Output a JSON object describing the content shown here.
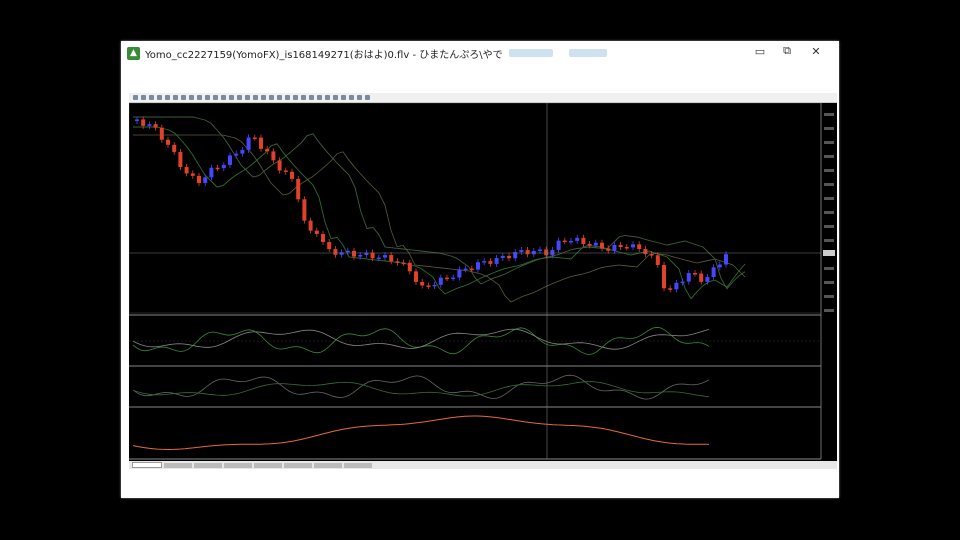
{
  "window": {
    "title": "Yomo_cc2227159(YomoFX)_is168149271(おはよ)0.flv - ひまたんぷろ\\やで",
    "icon_name": "app-icon",
    "controls": [
      "minimize-icon",
      "restore-icon",
      "close-icon"
    ]
  },
  "colors": {
    "bull_candle": "#4646ff",
    "bear_candle": "#e0412b",
    "background": "#000000",
    "grid": "#3a3a3a",
    "ma_line": "#2e6b2e",
    "osc_line": "#e86a3a"
  },
  "chart": {
    "symbol_label": "",
    "candle_count": 96
  }
}
